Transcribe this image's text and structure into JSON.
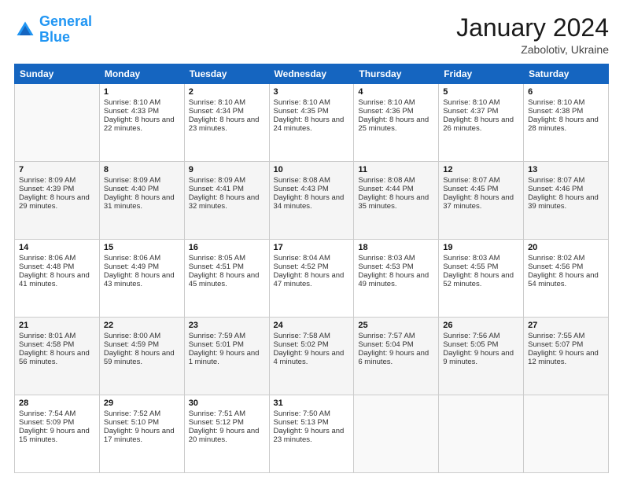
{
  "header": {
    "logo_line1": "General",
    "logo_line2": "Blue",
    "title": "January 2024",
    "subtitle": "Zabolotiv, Ukraine"
  },
  "calendar": {
    "headers": [
      "Sunday",
      "Monday",
      "Tuesday",
      "Wednesday",
      "Thursday",
      "Friday",
      "Saturday"
    ],
    "rows": [
      [
        {
          "day": "",
          "sunrise": "",
          "sunset": "",
          "daylight": ""
        },
        {
          "day": "1",
          "sunrise": "Sunrise: 8:10 AM",
          "sunset": "Sunset: 4:33 PM",
          "daylight": "Daylight: 8 hours and 22 minutes."
        },
        {
          "day": "2",
          "sunrise": "Sunrise: 8:10 AM",
          "sunset": "Sunset: 4:34 PM",
          "daylight": "Daylight: 8 hours and 23 minutes."
        },
        {
          "day": "3",
          "sunrise": "Sunrise: 8:10 AM",
          "sunset": "Sunset: 4:35 PM",
          "daylight": "Daylight: 8 hours and 24 minutes."
        },
        {
          "day": "4",
          "sunrise": "Sunrise: 8:10 AM",
          "sunset": "Sunset: 4:36 PM",
          "daylight": "Daylight: 8 hours and 25 minutes."
        },
        {
          "day": "5",
          "sunrise": "Sunrise: 8:10 AM",
          "sunset": "Sunset: 4:37 PM",
          "daylight": "Daylight: 8 hours and 26 minutes."
        },
        {
          "day": "6",
          "sunrise": "Sunrise: 8:10 AM",
          "sunset": "Sunset: 4:38 PM",
          "daylight": "Daylight: 8 hours and 28 minutes."
        }
      ],
      [
        {
          "day": "7",
          "sunrise": "Sunrise: 8:09 AM",
          "sunset": "Sunset: 4:39 PM",
          "daylight": "Daylight: 8 hours and 29 minutes."
        },
        {
          "day": "8",
          "sunrise": "Sunrise: 8:09 AM",
          "sunset": "Sunset: 4:40 PM",
          "daylight": "Daylight: 8 hours and 31 minutes."
        },
        {
          "day": "9",
          "sunrise": "Sunrise: 8:09 AM",
          "sunset": "Sunset: 4:41 PM",
          "daylight": "Daylight: 8 hours and 32 minutes."
        },
        {
          "day": "10",
          "sunrise": "Sunrise: 8:08 AM",
          "sunset": "Sunset: 4:43 PM",
          "daylight": "Daylight: 8 hours and 34 minutes."
        },
        {
          "day": "11",
          "sunrise": "Sunrise: 8:08 AM",
          "sunset": "Sunset: 4:44 PM",
          "daylight": "Daylight: 8 hours and 35 minutes."
        },
        {
          "day": "12",
          "sunrise": "Sunrise: 8:07 AM",
          "sunset": "Sunset: 4:45 PM",
          "daylight": "Daylight: 8 hours and 37 minutes."
        },
        {
          "day": "13",
          "sunrise": "Sunrise: 8:07 AM",
          "sunset": "Sunset: 4:46 PM",
          "daylight": "Daylight: 8 hours and 39 minutes."
        }
      ],
      [
        {
          "day": "14",
          "sunrise": "Sunrise: 8:06 AM",
          "sunset": "Sunset: 4:48 PM",
          "daylight": "Daylight: 8 hours and 41 minutes."
        },
        {
          "day": "15",
          "sunrise": "Sunrise: 8:06 AM",
          "sunset": "Sunset: 4:49 PM",
          "daylight": "Daylight: 8 hours and 43 minutes."
        },
        {
          "day": "16",
          "sunrise": "Sunrise: 8:05 AM",
          "sunset": "Sunset: 4:51 PM",
          "daylight": "Daylight: 8 hours and 45 minutes."
        },
        {
          "day": "17",
          "sunrise": "Sunrise: 8:04 AM",
          "sunset": "Sunset: 4:52 PM",
          "daylight": "Daylight: 8 hours and 47 minutes."
        },
        {
          "day": "18",
          "sunrise": "Sunrise: 8:03 AM",
          "sunset": "Sunset: 4:53 PM",
          "daylight": "Daylight: 8 hours and 49 minutes."
        },
        {
          "day": "19",
          "sunrise": "Sunrise: 8:03 AM",
          "sunset": "Sunset: 4:55 PM",
          "daylight": "Daylight: 8 hours and 52 minutes."
        },
        {
          "day": "20",
          "sunrise": "Sunrise: 8:02 AM",
          "sunset": "Sunset: 4:56 PM",
          "daylight": "Daylight: 8 hours and 54 minutes."
        }
      ],
      [
        {
          "day": "21",
          "sunrise": "Sunrise: 8:01 AM",
          "sunset": "Sunset: 4:58 PM",
          "daylight": "Daylight: 8 hours and 56 minutes."
        },
        {
          "day": "22",
          "sunrise": "Sunrise: 8:00 AM",
          "sunset": "Sunset: 4:59 PM",
          "daylight": "Daylight: 8 hours and 59 minutes."
        },
        {
          "day": "23",
          "sunrise": "Sunrise: 7:59 AM",
          "sunset": "Sunset: 5:01 PM",
          "daylight": "Daylight: 9 hours and 1 minute."
        },
        {
          "day": "24",
          "sunrise": "Sunrise: 7:58 AM",
          "sunset": "Sunset: 5:02 PM",
          "daylight": "Daylight: 9 hours and 4 minutes."
        },
        {
          "day": "25",
          "sunrise": "Sunrise: 7:57 AM",
          "sunset": "Sunset: 5:04 PM",
          "daylight": "Daylight: 9 hours and 6 minutes."
        },
        {
          "day": "26",
          "sunrise": "Sunrise: 7:56 AM",
          "sunset": "Sunset: 5:05 PM",
          "daylight": "Daylight: 9 hours and 9 minutes."
        },
        {
          "day": "27",
          "sunrise": "Sunrise: 7:55 AM",
          "sunset": "Sunset: 5:07 PM",
          "daylight": "Daylight: 9 hours and 12 minutes."
        }
      ],
      [
        {
          "day": "28",
          "sunrise": "Sunrise: 7:54 AM",
          "sunset": "Sunset: 5:09 PM",
          "daylight": "Daylight: 9 hours and 15 minutes."
        },
        {
          "day": "29",
          "sunrise": "Sunrise: 7:52 AM",
          "sunset": "Sunset: 5:10 PM",
          "daylight": "Daylight: 9 hours and 17 minutes."
        },
        {
          "day": "30",
          "sunrise": "Sunrise: 7:51 AM",
          "sunset": "Sunset: 5:12 PM",
          "daylight": "Daylight: 9 hours and 20 minutes."
        },
        {
          "day": "31",
          "sunrise": "Sunrise: 7:50 AM",
          "sunset": "Sunset: 5:13 PM",
          "daylight": "Daylight: 9 hours and 23 minutes."
        },
        {
          "day": "",
          "sunrise": "",
          "sunset": "",
          "daylight": ""
        },
        {
          "day": "",
          "sunrise": "",
          "sunset": "",
          "daylight": ""
        },
        {
          "day": "",
          "sunrise": "",
          "sunset": "",
          "daylight": ""
        }
      ]
    ]
  }
}
